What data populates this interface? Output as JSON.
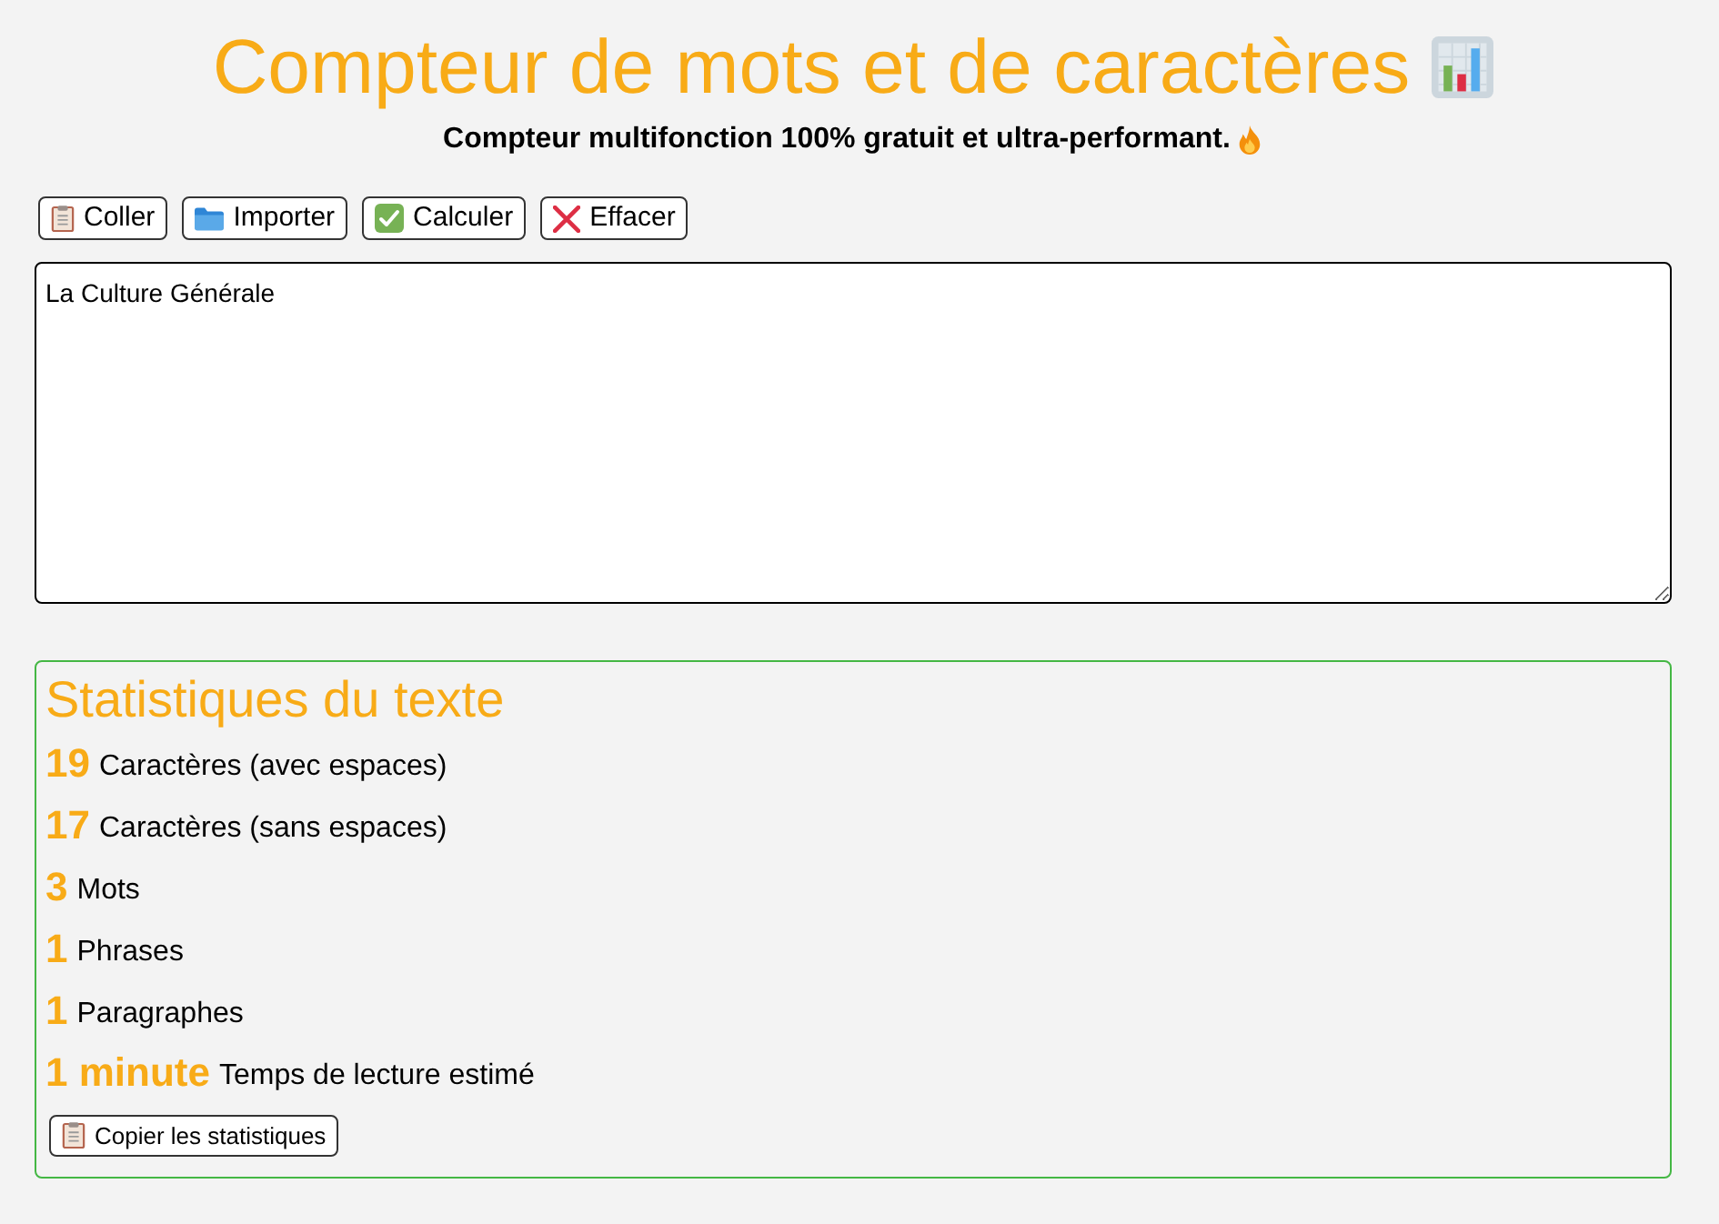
{
  "title": "Compteur de mots et de caractères",
  "subtitle": "Compteur multifonction 100% gratuit et ultra-performant.",
  "toolbar": [
    {
      "kind": "paste",
      "label": "Coller"
    },
    {
      "kind": "import",
      "label": "Importer"
    },
    {
      "kind": "calculate",
      "label": "Calculer"
    },
    {
      "kind": "clear",
      "label": "Effacer"
    }
  ],
  "text_area": {
    "value": "La Culture Générale"
  },
  "statistics": {
    "title": "Statistiques du texte",
    "items": [
      {
        "result": "19",
        "metric": "Caractères (avec espaces)"
      },
      {
        "result": "17",
        "metric": "Caractères (sans espaces)"
      },
      {
        "result": "3",
        "metric": "Mots"
      },
      {
        "result": "1",
        "metric": "Phrases"
      },
      {
        "result": "1",
        "metric": "Paragraphes"
      },
      {
        "result": "1 minute",
        "metric": "Temps de lecture estimé"
      }
    ],
    "copy_button": "Copier les statistiques"
  }
}
